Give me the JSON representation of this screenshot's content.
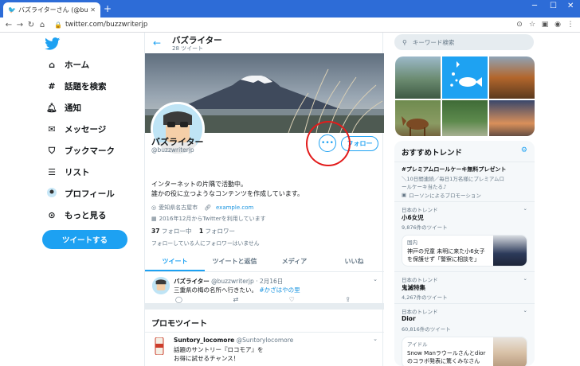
{
  "browser": {
    "tab_title": "バズライターさん (@buzzwriterjp) / T",
    "url": "twitter.com/buzzwriterjp"
  },
  "nav": {
    "items": [
      {
        "label": "ホーム",
        "icon": "home-icon"
      },
      {
        "label": "話題を検索",
        "icon": "hashtag-icon"
      },
      {
        "label": "通知",
        "icon": "bell-icon"
      },
      {
        "label": "メッセージ",
        "icon": "mail-icon"
      },
      {
        "label": "ブックマーク",
        "icon": "bookmark-icon"
      },
      {
        "label": "リスト",
        "icon": "list-icon"
      },
      {
        "label": "プロフィール",
        "icon": "avatar-icon"
      },
      {
        "label": "もっと見る",
        "icon": "more-icon"
      }
    ],
    "tweet_button": "ツイートする"
  },
  "profile": {
    "header_name": "バズライター",
    "header_sub": "28 ツイート",
    "name": "バズライター",
    "handle": "@buzzwriterjp",
    "bio_line1": "インターネットの片隅で活動中。",
    "bio_line2": "誰かの役に立つようなコンテンツを作成しています。",
    "location": "愛知県名古屋市",
    "website": "example.com",
    "joined": "2016年12月からTwitterを利用しています",
    "following_count": "37",
    "following_label": "フォロー中",
    "followers_count": "1",
    "followers_label": "フォロワー",
    "followed_by": "フォローしている人にフォロワーはいません",
    "follow_button": "フォロー",
    "more_button": "•••"
  },
  "tabs": [
    "ツイート",
    "ツイートと返信",
    "メディア",
    "いいね"
  ],
  "tweet": {
    "name": "バズライター",
    "handle": "@buzzwriterjp",
    "date": "· 2月16日",
    "text": "三重県の梅の名所へ行きたい。",
    "tag": "#かざはやの里"
  },
  "promo": {
    "header": "プロモツイート",
    "name": "Suntory_locomore",
    "handle": "@Suntorylocomore",
    "line1": "話題のサントリー『ロコモア』を",
    "line2": "お得に試せるチャンス！"
  },
  "right": {
    "search_placeholder": "キーワード検索",
    "trends_title": "おすすめトレンド",
    "t1_name": "#プレミアムロールケーキ無料プレゼント",
    "t1_desc1": "＼10日間連続／毎日1万名様にプレミアムロ",
    "t1_desc2": "ールケーキ当たる♪",
    "t1_promo": "ローソンによるプロモーション",
    "t2_cat": "日本のトレンド",
    "t2_name": "小6女児",
    "t2_count": "9,876件のツイート",
    "news1_cat": "国内",
    "news1_line1": "神戸の児童 未明に来た小6女子",
    "news1_line2": "を保護せず「警察に相談を」",
    "t3_cat": "日本のトレンド",
    "t3_name": "鬼滅特集",
    "t3_count": "4,267件のツイート",
    "t4_cat": "日本のトレンド",
    "t4_name": "Dior",
    "t4_count": "60,816件のツイート",
    "news2_cat": "アイドル",
    "news2_line1": "Snow Manラウールさんとdior",
    "news2_line2": "のコラボ発表に驚くみなさん"
  }
}
